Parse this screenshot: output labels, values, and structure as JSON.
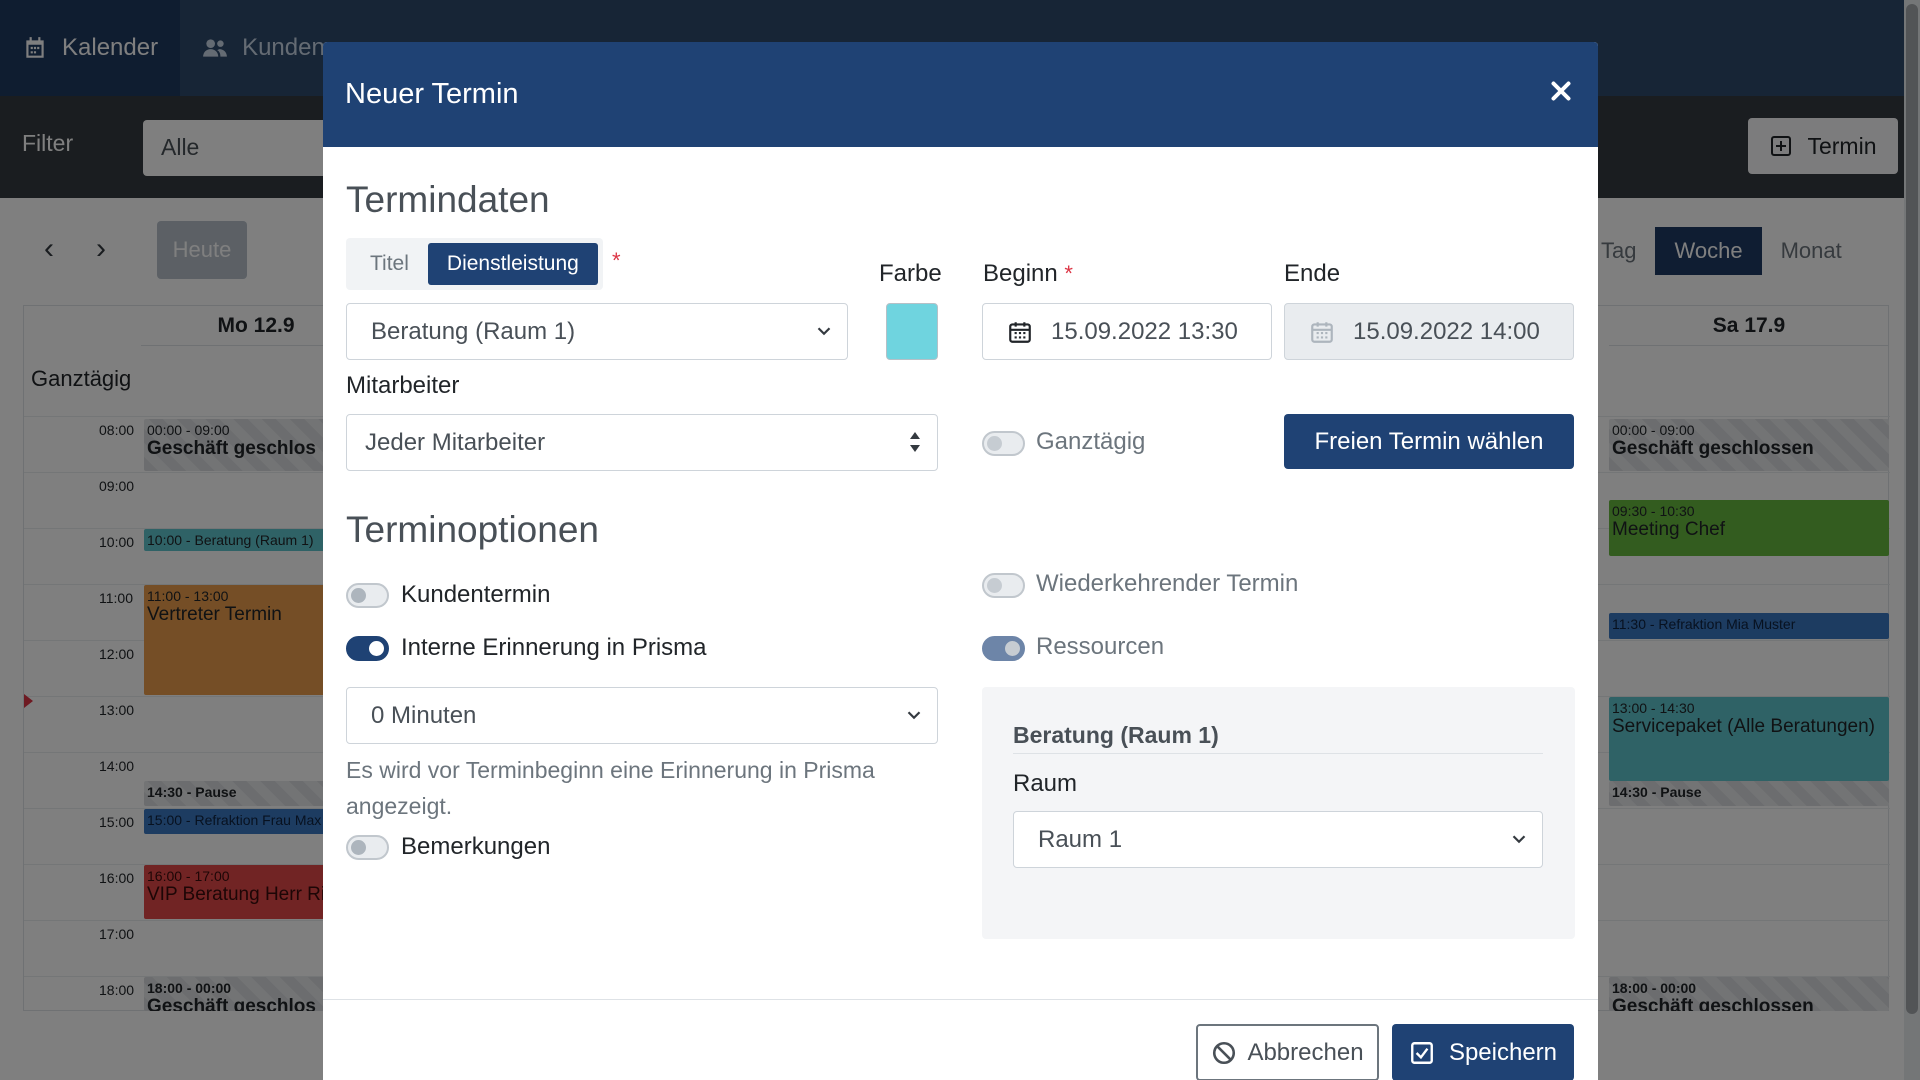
{
  "nav": {
    "items": [
      {
        "label": "Kalender",
        "icon": "calendar-icon",
        "active": true
      },
      {
        "label": "Kunden",
        "icon": "users-icon",
        "active": false
      },
      {
        "label": "",
        "icon": "document-icon",
        "active": false
      },
      {
        "label": "",
        "icon": "tools-icon",
        "active": false
      },
      {
        "label": "",
        "icon": "user-icon",
        "active": false
      },
      {
        "label": "",
        "icon": "group-icon",
        "active": false
      }
    ]
  },
  "filter": {
    "label": "Filter",
    "value": "Alle",
    "new_button_label": "Termin"
  },
  "calendar": {
    "today_label": "Heute",
    "views": [
      "Tag",
      "Woche",
      "Monat"
    ],
    "active_view": "Woche",
    "days": [
      "Mo 12.9",
      "Sa 17.9"
    ],
    "allday_label": "Ganztägig",
    "hours": [
      "08:00",
      "09:00",
      "10:00",
      "11:00",
      "12:00",
      "13:00",
      "14:00",
      "15:00",
      "16:00",
      "17:00",
      "18:00"
    ],
    "events_monday": [
      {
        "time": "00:00 - 09:00",
        "name": "Geschäft geschlos",
        "style": "closed"
      },
      {
        "time": "10:00 - Beratung (Raum 1)",
        "name": "",
        "style": "cyan"
      },
      {
        "time": "11:00 - 13:00",
        "name": "Vertreter Termin",
        "style": "orange"
      },
      {
        "time": "14:30 - Pause",
        "name": "",
        "style": "closed"
      },
      {
        "time": "15:00 - Refraktion Frau Max",
        "name": "",
        "style": "blue"
      },
      {
        "time": "16:00 - 17:00",
        "name": "VIP Beratung Herr Ri",
        "style": "red"
      },
      {
        "time": "18:00 - 00:00",
        "name": "Geschäft geschlos",
        "style": "closed"
      }
    ],
    "events_saturday": [
      {
        "time": "00:00 - 09:00",
        "name": "Geschäft geschlossen",
        "style": "closed"
      },
      {
        "time": "09:30 - 10:30",
        "name": "Meeting Chef",
        "style": "green"
      },
      {
        "time": "11:30 - Refraktion Mia Muster",
        "name": "",
        "style": "blue"
      },
      {
        "time": "13:00 - 14:30",
        "name": "Servicepaket (Alle Beratungen)",
        "style": "cyan"
      },
      {
        "time": "14:30 - Pause",
        "name": "",
        "style": "closed"
      },
      {
        "time": "18:00 - 00:00",
        "name": "Geschäft geschlossen",
        "style": "closed"
      }
    ]
  },
  "modal": {
    "title": "Neuer Termin",
    "section_data": "Termindaten",
    "type_toggle": {
      "options": [
        "Titel",
        "Dienstleistung"
      ],
      "selected": "Dienstleistung"
    },
    "required_marker": "*",
    "service_select": "Beratung (Raum 1)",
    "color_label": "Farbe",
    "color_value": "#6fd4df",
    "begin_label": "Beginn",
    "begin_value": "15.09.2022 13:30",
    "end_label": "Ende",
    "end_value": "15.09.2022 14:00",
    "employee_label": "Mitarbeiter",
    "employee_select": "Jeder Mitarbeiter",
    "allday_label": "Ganztägig",
    "allday_on": false,
    "free_slot_button": "Freien Termin wählen",
    "section_options": "Terminoptionen",
    "customer_appointment": {
      "label": "Kundentermin",
      "on": false
    },
    "internal_reminder": {
      "label": "Interne Erinnerung in Prisma",
      "on": true
    },
    "reminder_select": "0 Minuten",
    "reminder_help": "Es wird vor Terminbeginn eine Erinnerung in Prisma angezeigt.",
    "remarks": {
      "label": "Bemerkungen",
      "on": false
    },
    "recurring": {
      "label": "Wiederkehrender Termin",
      "on": false
    },
    "resources": {
      "label": "Ressourcen",
      "on": true
    },
    "resource_panel": {
      "title": "Beratung (Raum 1)",
      "room_label": "Raum",
      "room_select": "Raum 1"
    },
    "cancel_button": "Abbrechen",
    "save_button": "Speichern"
  }
}
